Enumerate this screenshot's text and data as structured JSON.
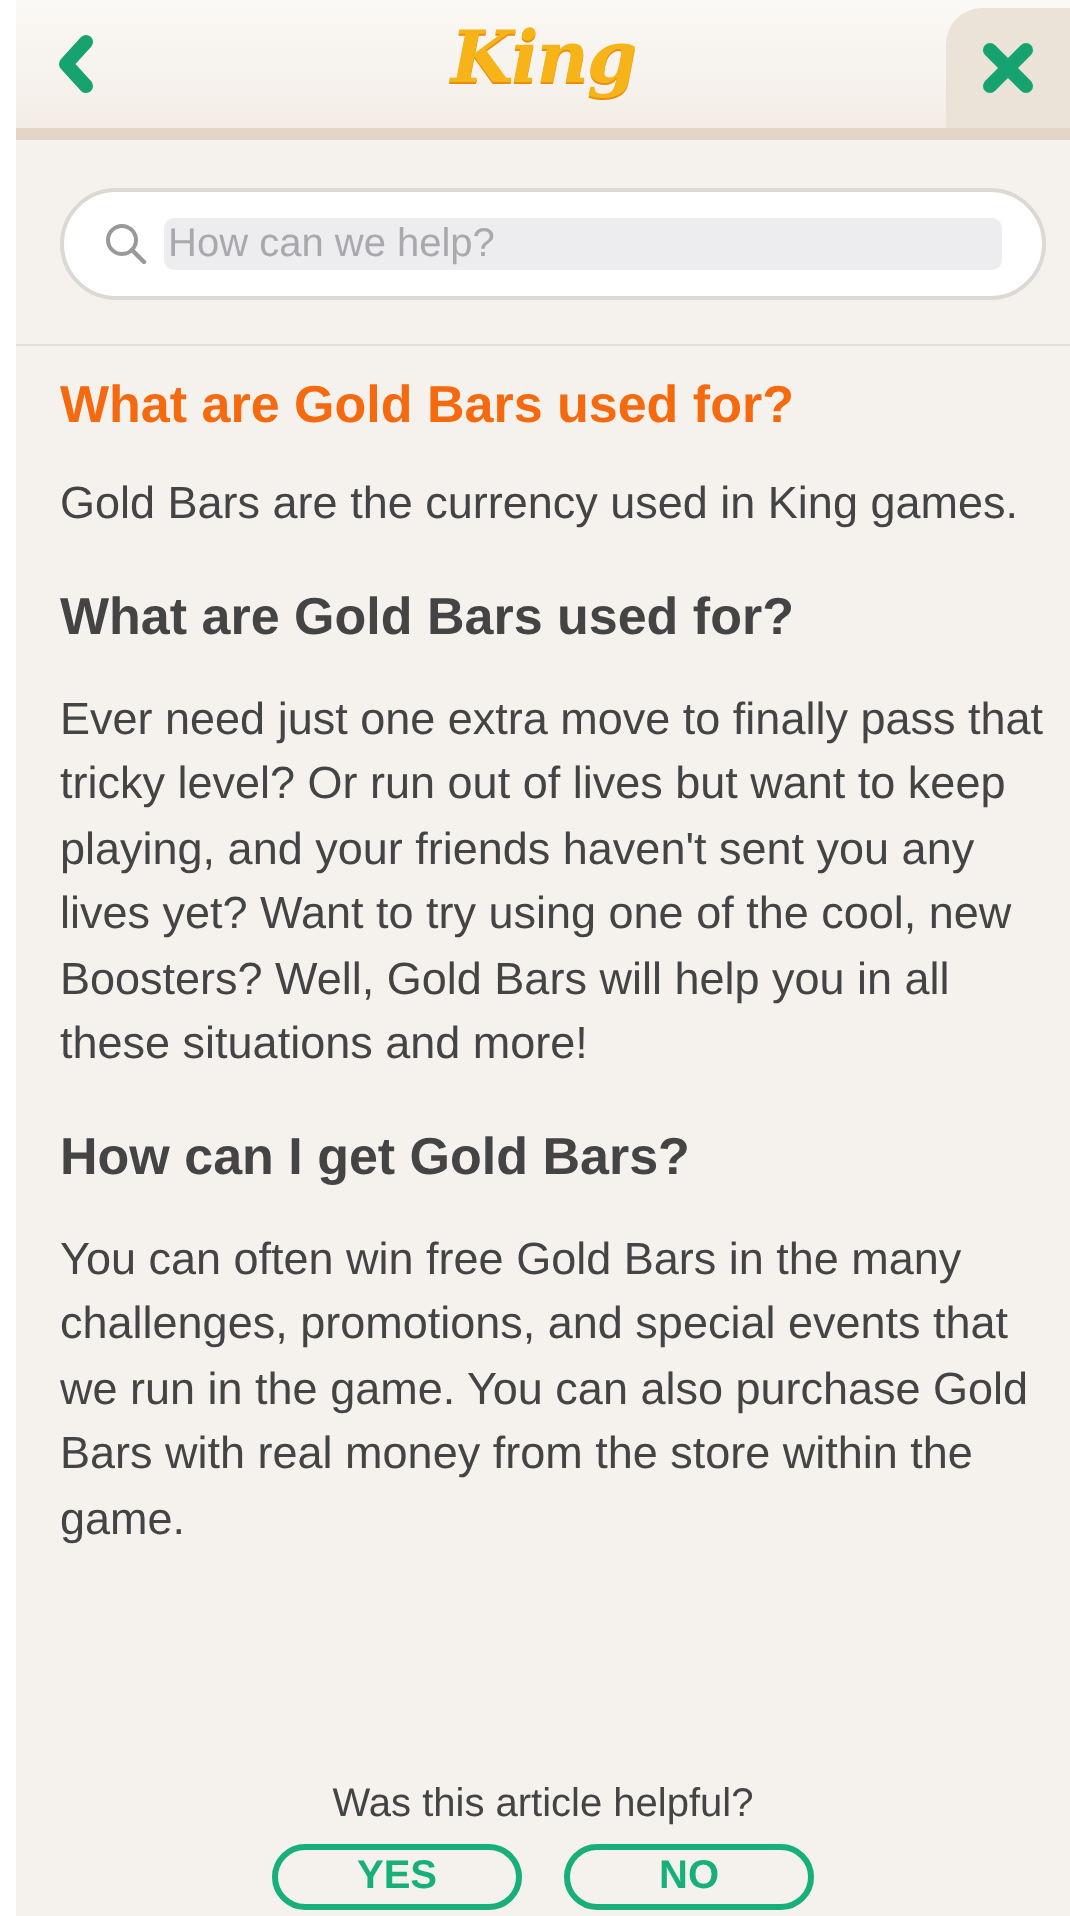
{
  "header": {
    "logo": "King"
  },
  "search": {
    "placeholder": "How can we help?"
  },
  "article": {
    "title": "What are Gold Bars used for?",
    "blocks": [
      {
        "kind": "paragraph",
        "text": "Gold Bars are the currency used in King games."
      },
      {
        "kind": "heading",
        "text": "What are Gold Bars used for?"
      },
      {
        "kind": "paragraph",
        "text": "Ever need just one extra move to finally pass that tricky level? Or run out of lives but want to keep playing, and your friends haven't sent you any lives yet? Want to try using one of the cool, new Boosters? Well, Gold Bars will help you in all these situations and more!"
      },
      {
        "kind": "heading",
        "text": "How can I get Gold Bars?"
      },
      {
        "kind": "paragraph",
        "text": "You can often win free Gold Bars in the many challenges, promotions, and special events that we run in the game. You can also purchase Gold Bars with real money from the store within the game."
      }
    ]
  },
  "feedback": {
    "question": "Was this article helpful?",
    "buttons": [
      "YES",
      "NO"
    ]
  }
}
